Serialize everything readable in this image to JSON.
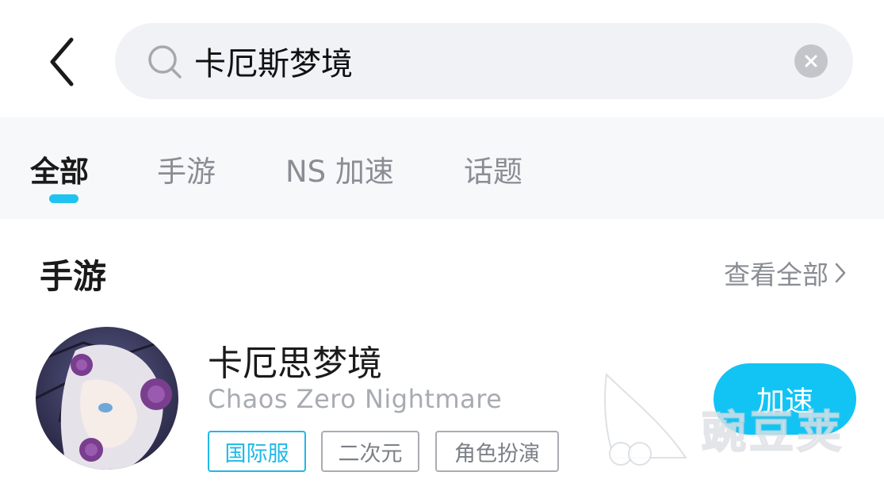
{
  "search": {
    "value": "卡厄斯梦境",
    "placeholder": ""
  },
  "tabs": [
    {
      "label": "全部",
      "active": true
    },
    {
      "label": "手游",
      "active": false
    },
    {
      "label": "NS 加速",
      "active": false
    },
    {
      "label": "话题",
      "active": false
    }
  ],
  "section": {
    "title": "手游",
    "view_all_label": "查看全部"
  },
  "game": {
    "name": "卡厄思梦境",
    "subtitle": "Chaos Zero Nightmare",
    "tags": [
      "国际服",
      "二次元",
      "角色扮演"
    ],
    "action_label": "加速"
  },
  "watermark": {
    "text": "豌豆荚"
  },
  "colors": {
    "accent": "#12c4f4",
    "tab_indicator": "#1fc3f0",
    "search_bg": "#f1f2f6",
    "tabs_bg": "#f7f8fa"
  },
  "icons": {
    "back": "chevron-left-icon",
    "search": "search-icon",
    "clear": "close-icon",
    "view_all": "chevron-right-icon"
  }
}
